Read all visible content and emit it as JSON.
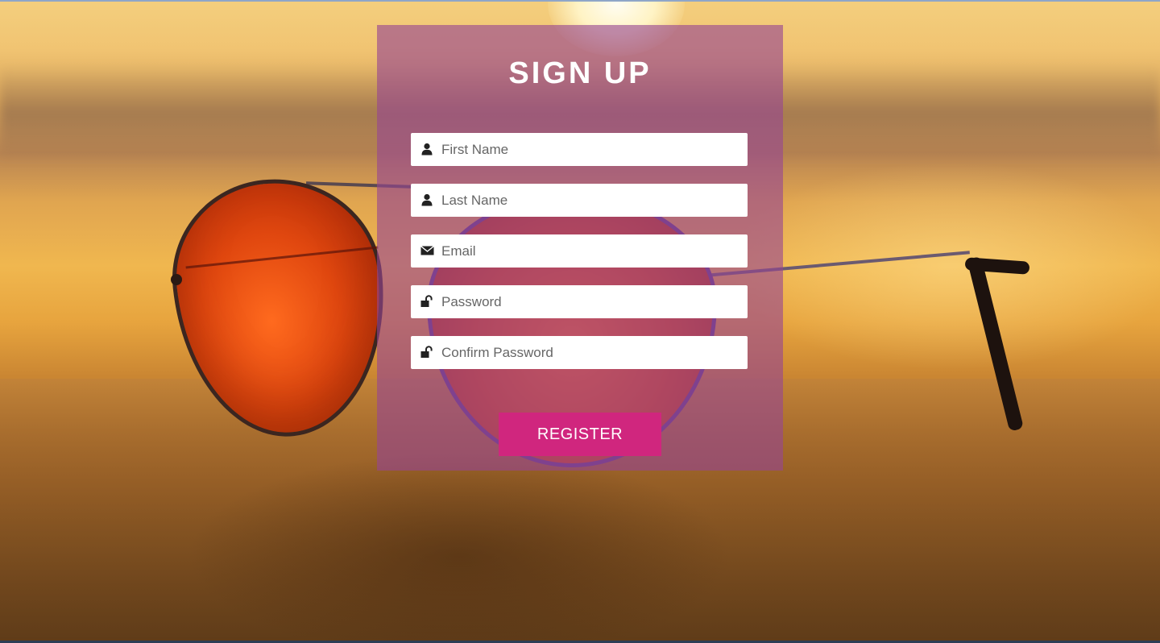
{
  "form": {
    "title": "SIGN UP",
    "fields": [
      {
        "placeholder": "First Name",
        "icon": "user-icon"
      },
      {
        "placeholder": "Last Name",
        "icon": "user-icon"
      },
      {
        "placeholder": "Email",
        "icon": "envelope-icon"
      },
      {
        "placeholder": "Password",
        "icon": "unlock-icon"
      },
      {
        "placeholder": "Confirm Password",
        "icon": "unlock-icon"
      }
    ],
    "submit_label": "REGISTER"
  },
  "colors": {
    "panel": "#964691",
    "button": "#d0267e",
    "text": "#ffffff"
  }
}
